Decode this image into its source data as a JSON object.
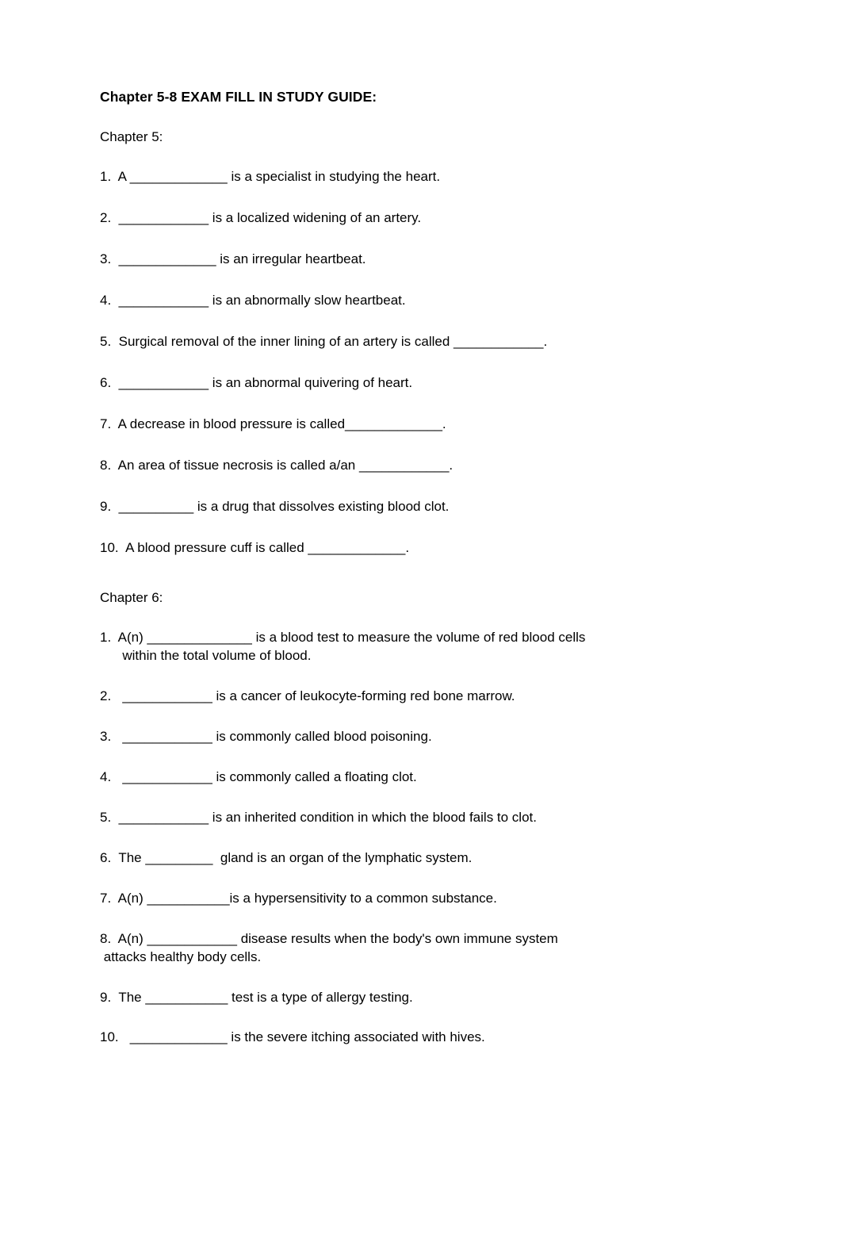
{
  "document": {
    "title": "Chapter 5-8 EXAM FILL IN STUDY GUIDE:",
    "chapter5": {
      "heading": "Chapter 5:",
      "questions": [
        "1.  A _____________ is a specialist in studying the heart.",
        "2.  ____________ is a localized widening of an artery.",
        "3.  _____________ is an irregular heartbeat.",
        "4.  ____________ is an abnormally slow heartbeat.",
        "5.  Surgical removal of the inner lining of an artery is called ____________.",
        "6.  ____________ is an abnormal quivering of heart.",
        "7.  A decrease in blood pressure is called_____________.",
        "8.  An area of tissue necrosis is called a/an ____________.",
        "9.  __________ is a drug that dissolves existing blood clot.",
        "10.  A blood pressure cuff is called _____________."
      ]
    },
    "chapter6": {
      "heading": "Chapter 6:",
      "questions": [
        "1.  A(n) ______________ is a blood test to measure the volume of red blood cells\n      within the total volume of blood.",
        "2.   ____________ is a cancer of leukocyte-forming red bone marrow.",
        "3.   ____________ is commonly called blood poisoning.",
        "4.   ____________ is commonly called a floating clot.",
        "5.  ____________ is an inherited condition in which the blood fails to clot.",
        "6.  The _________  gland is an organ of the lymphatic system.",
        "7.  A(n) ___________is a hypersensitivity to a common substance.",
        "8.  A(n) ____________ disease results when the body's own immune system\n attacks healthy body cells.",
        "9.  The ___________ test is a type of allergy testing.",
        "10.   _____________ is the severe itching associated with hives."
      ]
    }
  }
}
